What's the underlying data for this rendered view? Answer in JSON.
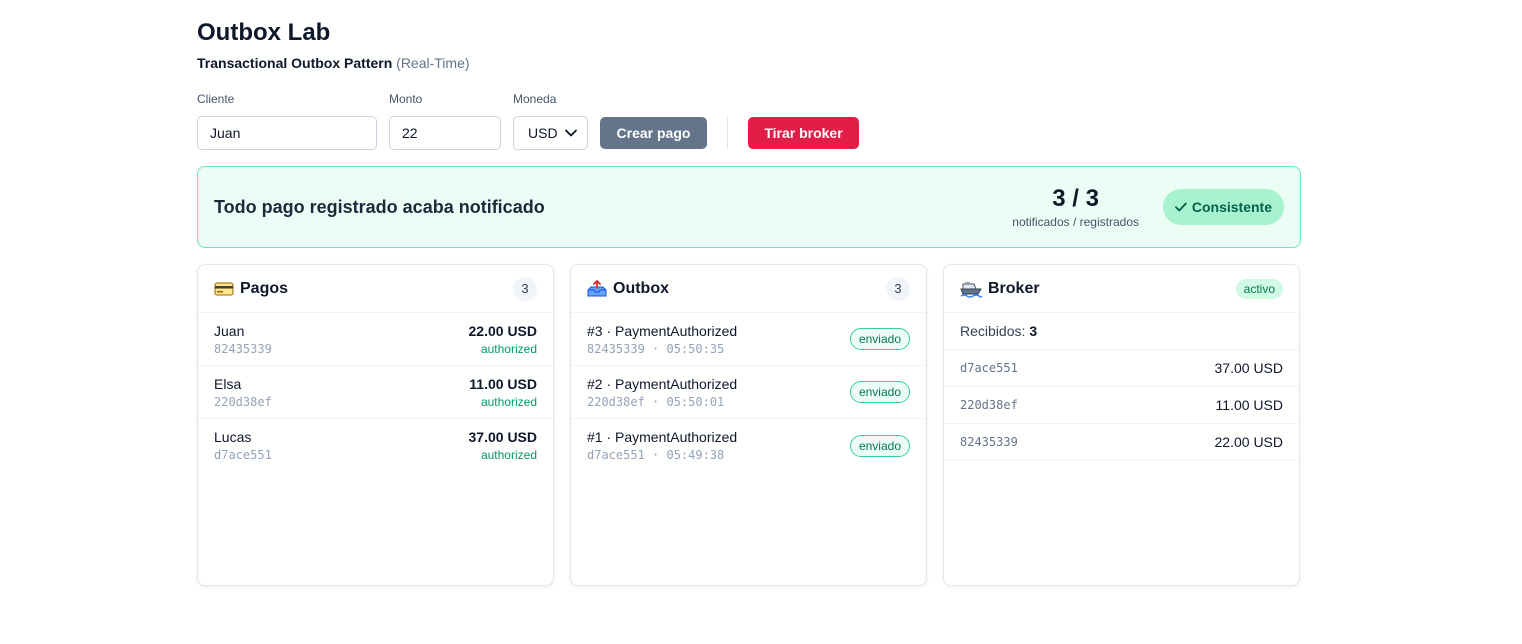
{
  "header": {
    "title": "Outbox Lab",
    "subtitle_bold": "Transactional Outbox Pattern",
    "subtitle_muted": "(Real-Time)"
  },
  "form": {
    "cliente_label": "Cliente",
    "cliente_value": "Juan",
    "monto_label": "Monto",
    "monto_value": "22",
    "moneda_label": "Moneda",
    "moneda_value": "USD",
    "create_label": "Crear pago",
    "kill_label": "Tirar broker"
  },
  "banner": {
    "text": "Todo pago registrado acaba notificado",
    "metric": "3 / 3",
    "metric_label": "notificados / registrados",
    "status": "Consistente"
  },
  "pagos": {
    "icon": "credit-card-icon",
    "title": "Pagos",
    "count": "3",
    "items": [
      {
        "name": "Juan",
        "id": "82435339",
        "amount": "22.00 USD",
        "status": "authorized"
      },
      {
        "name": "Elsa",
        "id": "220d38ef",
        "amount": "11.00 USD",
        "status": "authorized"
      },
      {
        "name": "Lucas",
        "id": "d7ace551",
        "amount": "37.00 USD",
        "status": "authorized"
      }
    ]
  },
  "outbox": {
    "icon": "outbox-tray-icon",
    "title": "Outbox",
    "count": "3",
    "items": [
      {
        "event": "#3 · PaymentAuthorized",
        "meta": "82435339 · 05:50:35",
        "status": "enviado"
      },
      {
        "event": "#2 · PaymentAuthorized",
        "meta": "220d38ef · 05:50:01",
        "status": "enviado"
      },
      {
        "event": "#1 · PaymentAuthorized",
        "meta": "d7ace551 · 05:49:38",
        "status": "enviado"
      }
    ]
  },
  "broker": {
    "icon": "ship-icon",
    "title": "Broker",
    "status": "activo",
    "received_label": "Recibidos:",
    "received_count": "3",
    "items": [
      {
        "id": "d7ace551",
        "amount": "37.00 USD"
      },
      {
        "id": "220d38ef",
        "amount": "11.00 USD"
      },
      {
        "id": "82435339",
        "amount": "22.00 USD"
      }
    ]
  },
  "colors": {
    "primary_gray": "#64748b",
    "danger": "#e11d48",
    "success_bg": "#ecfdf5",
    "success_border": "#6ee7b7",
    "success_text": "#059669"
  }
}
